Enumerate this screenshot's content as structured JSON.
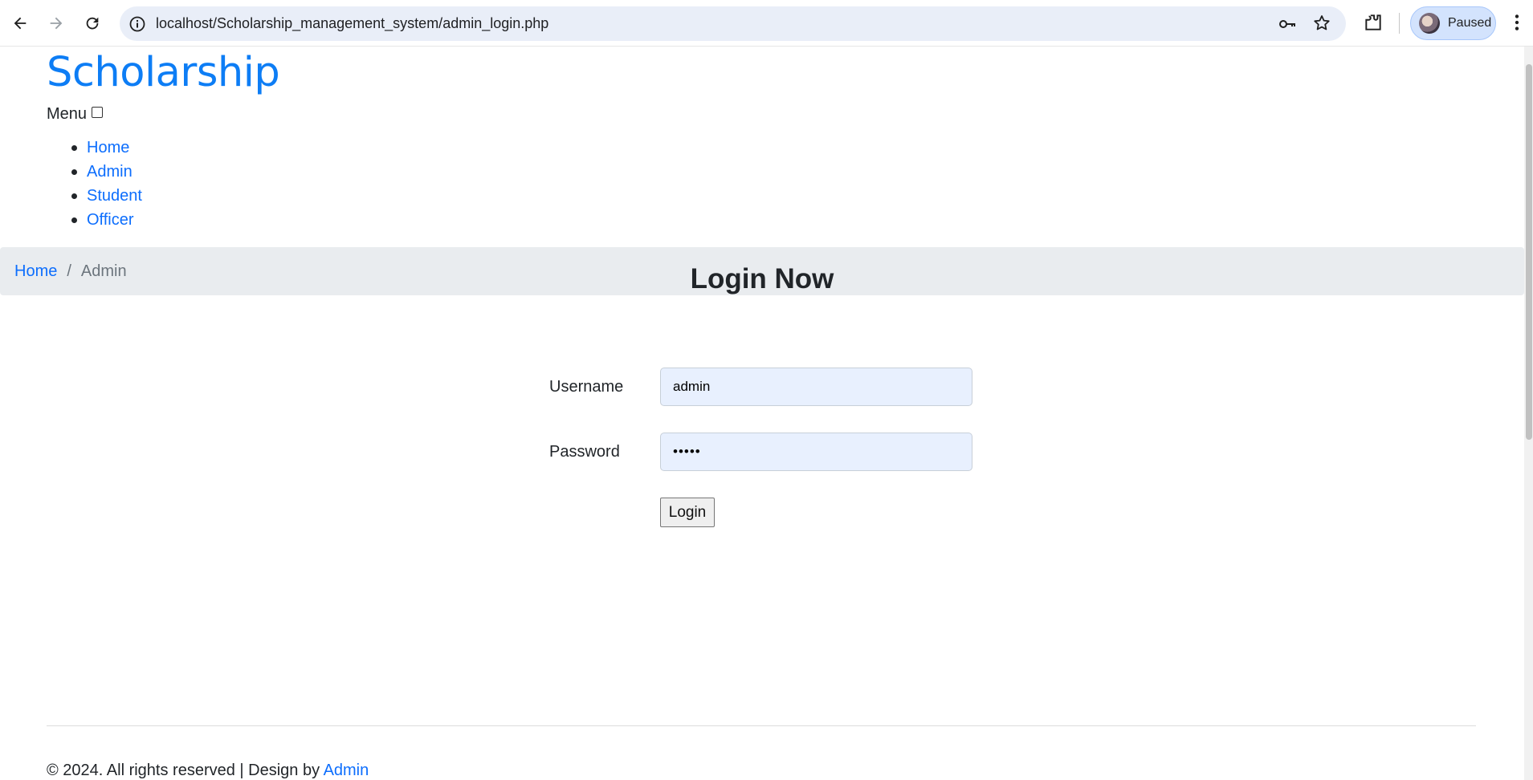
{
  "browser": {
    "url": "localhost/Scholarship_management_system/admin_login.php",
    "profile_label": "Paused",
    "icons": [
      "back-arrow-icon",
      "forward-arrow-icon",
      "reload-icon",
      "site-info-icon",
      "password-key-icon",
      "bookmark-star-icon",
      "extensions-icon",
      "profile-avatar",
      "more-menu-icon"
    ]
  },
  "header": {
    "brand": "Scholarship",
    "menu_label": "Menu",
    "nav_items": [
      "Home",
      "Admin",
      "Student",
      "Officer"
    ]
  },
  "breadcrumb": {
    "home": "Home",
    "separator": "/",
    "current": "Admin"
  },
  "login": {
    "title": "Login Now",
    "username_label": "Username",
    "username_value": "admin",
    "password_label": "Password",
    "password_value": "•••••",
    "button_label": "Login"
  },
  "footer": {
    "text": "© 2024. All rights reserved | Design by ",
    "link": "Admin"
  },
  "colors": {
    "brand": "#0d7df5",
    "link": "#0d6efd",
    "breadcrumb_bg": "#e9ecef",
    "autofill_bg": "#e8f0fe"
  }
}
